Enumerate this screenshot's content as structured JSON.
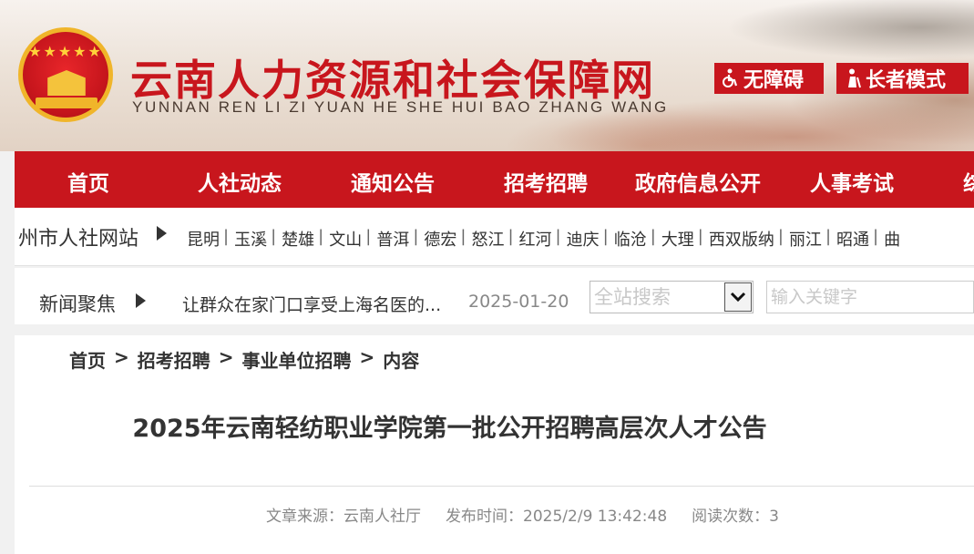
{
  "header": {
    "site_title": "云南人力资源和社会保障网",
    "site_pinyin": "YUNNAN REN LI ZI YUAN HE SHE HUI BAO ZHANG WANG",
    "accessibility_label": "无障碍",
    "elder_mode_label": "长者模式"
  },
  "nav": {
    "items": [
      "首页",
      "人社动态",
      "通知公告",
      "招考招聘",
      "政府信息公开",
      "人事考试",
      "综"
    ]
  },
  "cities": {
    "title": "州市人社网站",
    "items": [
      "昆明",
      "玉溪",
      "楚雄",
      "文山",
      "普洱",
      "德宏",
      "怒江",
      "红河",
      "迪庆",
      "临沧",
      "大理",
      "西双版纳",
      "丽江",
      "昭通",
      "曲"
    ]
  },
  "news": {
    "label": "新闻聚焦",
    "headline": "让群众在家门口享受上海名医的...",
    "date": "2025-01-20"
  },
  "search": {
    "scope_value": "全站搜索",
    "keyword_placeholder": "输入关键字"
  },
  "breadcrumb": {
    "items": [
      "首页",
      "招考招聘",
      "事业单位招聘",
      "内容"
    ],
    "separator": ">"
  },
  "article": {
    "title": "2025年云南轻纺职业学院第一批公开招聘高层次人才公告",
    "source": "文章来源：云南人社厅",
    "published": "发布时间：2025/2/9 13:42:48",
    "reads": "阅读次数：3"
  },
  "colors": {
    "brand_red": "#c8161d",
    "gold": "#f0b52a"
  }
}
